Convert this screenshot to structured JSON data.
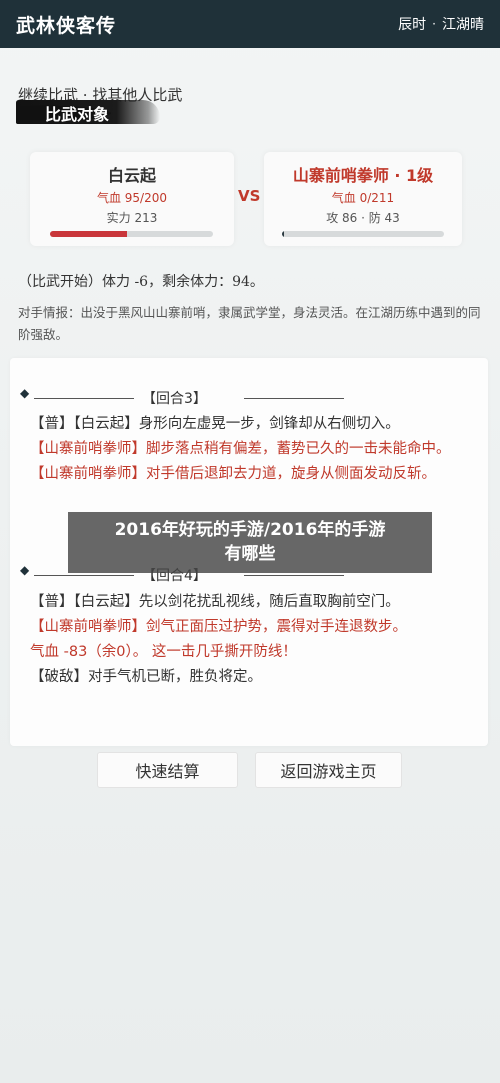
{
  "header": {
    "title": "武林侠客传",
    "time": "辰时",
    "dot": "·",
    "weather": "江湖晴"
  },
  "links": {
    "continue": "继续比武",
    "sep": "·",
    "other": "找其他人比武"
  },
  "section": {
    "title": "比武对象"
  },
  "player": {
    "name": "白云起",
    "hp_label": "气血 95/200",
    "power": "实力 213",
    "hp_fraction": 0.475
  },
  "vs": "VS",
  "enemy": {
    "name": "山寨前哨拳师 · 1级",
    "hp_label": "气血 0/211",
    "stats": "攻 86 · 防 43",
    "hp_fraction": 0.0
  },
  "battle_start": "（比武开始）体力 -6，剩余体力：94。",
  "intel": "对手情报：出没于黑风山山寨前哨，隶属武学堂，身法灵活。在江湖历练中遇到的同阶强敌。",
  "rounds": [
    {
      "label": "【回合3】",
      "entries": [
        {
          "text": "【普】【白云起】身形向左虚晃一步，剑锋却从右侧切入。",
          "color": "dark"
        },
        {
          "text": "【山寨前哨拳师】脚步落点稍有偏差，蓄势已久的一击未能命中。",
          "color": "red"
        },
        {
          "text": "【山寨前哨拳师】对手借后退卸去力道，旋身从侧面发动反斩。",
          "color": "red"
        }
      ]
    },
    {
      "label": "【回合4】",
      "entries": [
        {
          "text": "【普】【白云起】先以剑花扰乱视线，随后直取胸前空门。",
          "color": "dark"
        },
        {
          "text": "【山寨前哨拳师】剑气正面压过护势，震得对手连退数步。",
          "color": "red"
        },
        {
          "text": "气血 -83（余0）。 这一击几乎撕开防线！",
          "color": "red"
        },
        {
          "text": "【破敌】对手气机已断，胜负将定。",
          "color": "dark"
        }
      ]
    }
  ],
  "buttons": {
    "quick": "快速结算",
    "home": "返回游戏主页"
  },
  "overlay": {
    "line1": "2016年好玩的手游/2016年的手游",
    "line2": "有哪些"
  }
}
